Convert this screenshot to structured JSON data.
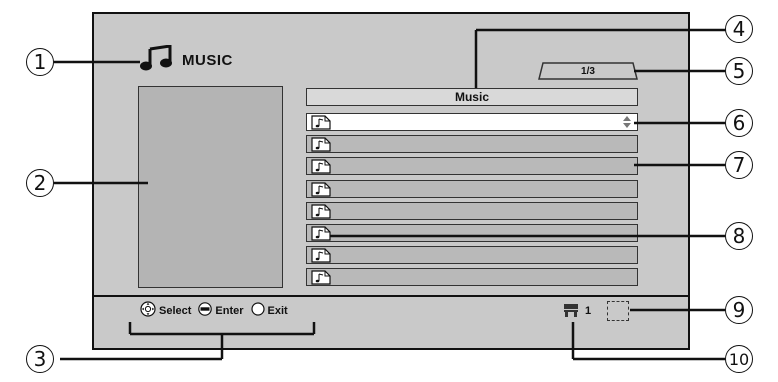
{
  "screen": {
    "title": "MUSIC",
    "page_indicator": "1/3",
    "folder_name": "Music",
    "files": [
      {
        "label": "",
        "selected": true
      },
      {
        "label": "",
        "selected": false
      },
      {
        "label": "",
        "selected": false
      },
      {
        "label": "",
        "selected": false
      },
      {
        "label": "",
        "selected": false
      },
      {
        "label": "",
        "selected": false
      },
      {
        "label": "",
        "selected": false
      },
      {
        "label": "",
        "selected": false
      }
    ]
  },
  "footer": {
    "select_label": "Select",
    "enter_label": "Enter",
    "exit_label": "Exit"
  },
  "status": {
    "disc_count": "1"
  },
  "callouts": [
    "1",
    "2",
    "3",
    "4",
    "5",
    "6",
    "7",
    "8",
    "9",
    "10"
  ],
  "icons": {
    "title": "music-note-icon",
    "file": "music-file-icon",
    "select": "dpad-icon",
    "enter": "enter-button-icon",
    "exit": "exit-button-icon",
    "status": "disc-tray-icon",
    "scroll": "scroll-updown-icon"
  }
}
